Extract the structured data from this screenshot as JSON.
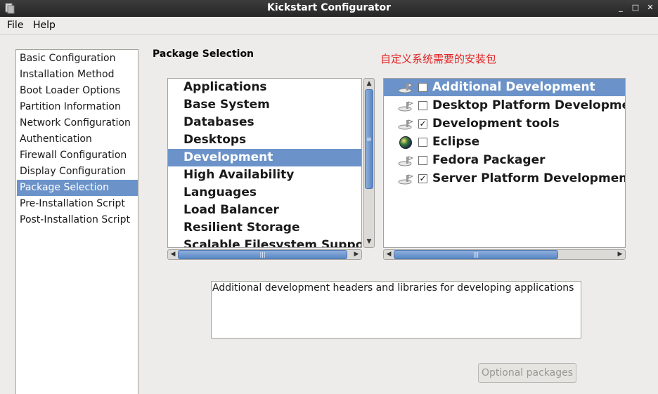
{
  "window": {
    "title": "Kickstart Configurator"
  },
  "menubar": {
    "items": [
      "File",
      "Help"
    ]
  },
  "nav": {
    "items": [
      "Basic Configuration",
      "Installation Method",
      "Boot Loader Options",
      "Partition Information",
      "Network Configuration",
      "Authentication",
      "Firewall Configuration",
      "Display Configuration",
      "Package Selection",
      "Pre-Installation Script",
      "Post-Installation Script"
    ],
    "selected": "Package Selection"
  },
  "main": {
    "section_title": "Package Selection",
    "annotation": "自定义系统需要的安装包",
    "categories": [
      "Applications",
      "Base System",
      "Databases",
      "Desktops",
      "Development",
      "High Availability",
      "Languages",
      "Load Balancer",
      "Resilient Storage",
      "Scalable Filesystem Support"
    ],
    "selected_category": "Development",
    "package_groups": [
      {
        "label": "Additional Development",
        "checked": false,
        "icon": "package-group-icon",
        "selected": true
      },
      {
        "label": "Desktop Platform Development",
        "checked": false,
        "icon": "package-group-icon",
        "selected": false
      },
      {
        "label": "Development tools",
        "checked": true,
        "icon": "package-group-icon",
        "selected": false
      },
      {
        "label": "Eclipse",
        "checked": false,
        "icon": "eclipse-globe-icon",
        "selected": false
      },
      {
        "label": "Fedora Packager",
        "checked": false,
        "icon": "package-group-icon",
        "selected": false
      },
      {
        "label": "Server Platform Development",
        "checked": true,
        "icon": "package-group-icon",
        "selected": false
      }
    ],
    "check_glyph": "✓",
    "description": "Additional development headers and libraries for developing applications",
    "optional_packages_label": "Optional packages"
  },
  "colors": {
    "selection": "#6b93c9",
    "annotation": "#e02020",
    "titlebar": "#2f2f2f"
  }
}
